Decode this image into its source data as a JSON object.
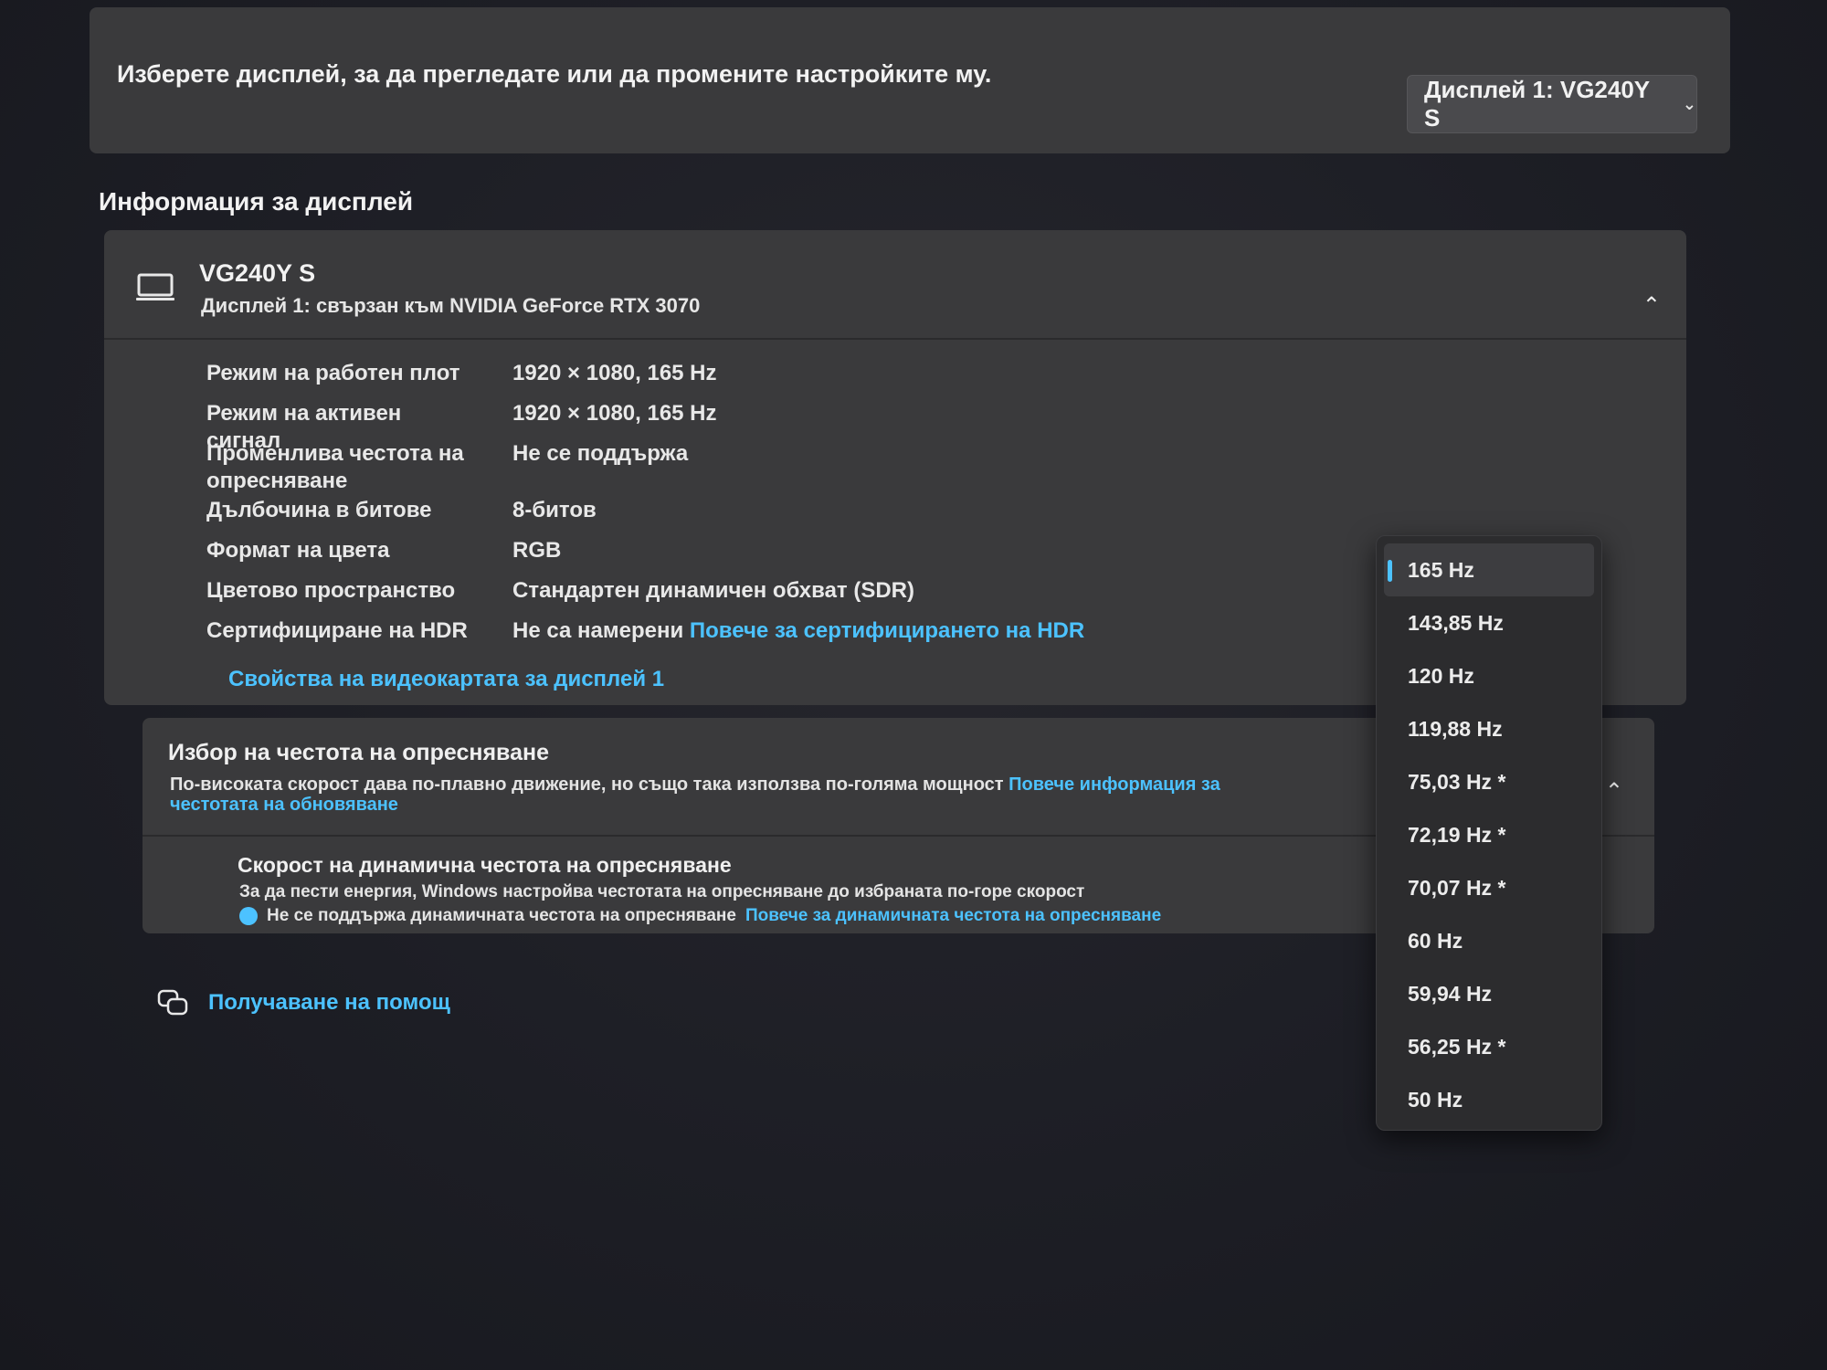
{
  "select_display": {
    "prompt": "Изберете дисплей, за да прегледате или да промените настройките му.",
    "dropdown_value": "Дисплей 1: VG240Y S"
  },
  "display_info": {
    "section_title": "Информация за дисплей",
    "monitor_name": "VG240Y S",
    "monitor_subtitle": "Дисплей 1: свързан към NVIDIA GeForce RTX 3070",
    "rows": [
      {
        "label": "Режим на работен плот",
        "value": "1920 × 1080, 165 Hz"
      },
      {
        "label": "Режим на активен сигнал",
        "value": "1920 × 1080, 165 Hz"
      },
      {
        "label": "Променлива честота на опресняване",
        "value": "Не се поддържа"
      },
      {
        "label": "Дълбочина в битове",
        "value": "8-битов"
      },
      {
        "label": "Формат на цвета",
        "value": "RGB"
      },
      {
        "label": "Цветово пространство",
        "value": "Стандартен динамичен обхват (SDR)"
      },
      {
        "label": "Сертифициране на HDR",
        "value": "Не са намерени",
        "link": "Повече за сертифицирането на HDR"
      }
    ],
    "adapter_link": "Свойства на видеокартата за дисплей 1"
  },
  "refresh_rate": {
    "title": "Избор на честота на опресняване",
    "description": "По-високата скорост дава по-плавно движение, но също така използва по-голяма мощност",
    "description_link": "Повече информация за честотата на обновяване",
    "dynamic_title": "Скорост на динамична честота на опресняване",
    "dynamic_desc": "За да пести енергия, Windows настройва честотата на опресняване до избраната по-горе скорост",
    "dynamic_status": "Не се поддържа динамичната честота на опресняване",
    "dynamic_link": "Повече за динамичната честота на опресняване"
  },
  "help": {
    "label": "Получаване на помощ"
  },
  "rate_options": {
    "selected": "165 Hz",
    "items": [
      "165 Hz",
      "143,85 Hz",
      "120 Hz",
      "119,88 Hz",
      "75,03 Hz *",
      "72,19 Hz *",
      "70,07 Hz *",
      "60 Hz",
      "59,94 Hz",
      "56,25 Hz *",
      "50 Hz"
    ]
  },
  "colors": {
    "accent": "#4cc2ff",
    "card": "#3a3a3c",
    "background": "#1d1e25"
  },
  "icons": [
    "monitor-icon",
    "chevron-down-icon",
    "chevron-up-icon",
    "info-icon",
    "help-icon"
  ]
}
